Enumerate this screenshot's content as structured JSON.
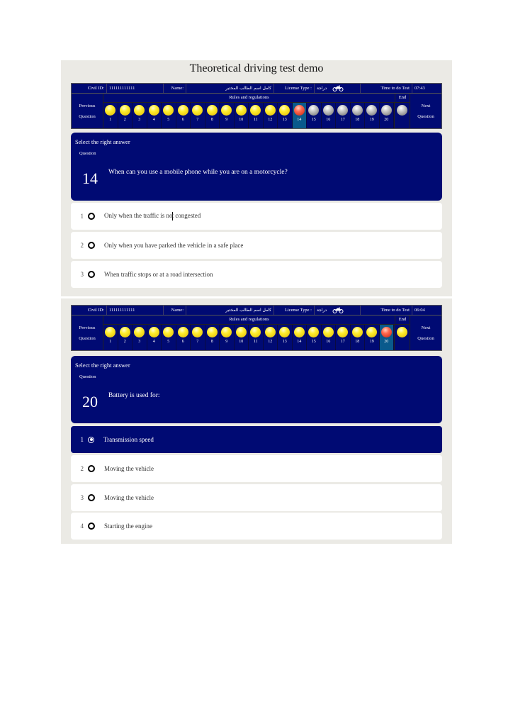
{
  "page": {
    "title": "Theoretical driving test demo"
  },
  "screens": [
    {
      "info": {
        "civil_id_label": "Civil ID:",
        "civil_id": "111111111111",
        "name_label": "Name:",
        "name": "كامل اسم الطالب المختبر",
        "license_label": "License Type :",
        "license": "دراجة",
        "license_icon": "motorcycle-icon",
        "time_label": "Time to do Test",
        "time": "07:43"
      },
      "nav": {
        "previous": [
          "Previous",
          "Question"
        ],
        "next": [
          "Next",
          "Question"
        ],
        "section": "Rules and regulations",
        "end_label": "End",
        "current": 14,
        "questions": [
          {
            "n": "1",
            "state": "answered"
          },
          {
            "n": "2",
            "state": "answered"
          },
          {
            "n": "3",
            "state": "answered"
          },
          {
            "n": "4",
            "state": "answered"
          },
          {
            "n": "5",
            "state": "answered"
          },
          {
            "n": "6",
            "state": "answered"
          },
          {
            "n": "7",
            "state": "answered"
          },
          {
            "n": "8",
            "state": "answered"
          },
          {
            "n": "9",
            "state": "answered"
          },
          {
            "n": "10",
            "state": "answered"
          },
          {
            "n": "11",
            "state": "answered"
          },
          {
            "n": "12",
            "state": "answered"
          },
          {
            "n": "13",
            "state": "answered"
          },
          {
            "n": "14",
            "state": "current"
          },
          {
            "n": "15",
            "state": "unanswered"
          },
          {
            "n": "16",
            "state": "unanswered"
          },
          {
            "n": "17",
            "state": "unanswered"
          },
          {
            "n": "18",
            "state": "unanswered"
          },
          {
            "n": "19",
            "state": "unanswered"
          },
          {
            "n": "20",
            "state": "unanswered"
          }
        ],
        "end_state": "unanswered"
      },
      "question": {
        "instruction": "Select the right answer",
        "label": "Question",
        "number": "14",
        "text": "When can you use a mobile phone while you are on a motorcycle?"
      },
      "answers": [
        {
          "n": "1",
          "text_before": "Only when the traffic is no",
          "text_after": "t congested",
          "selected": false
        },
        {
          "n": "2",
          "text": "Only when you have parked the vehicle in a safe place",
          "selected": false
        },
        {
          "n": "3",
          "text": "When traffic stops or at a road intersection",
          "selected": false
        }
      ]
    },
    {
      "info": {
        "civil_id_label": "Civil ID:",
        "civil_id": "111111111111",
        "name_label": "Name:",
        "name": "كامل اسم الطالب المختبر",
        "license_label": "License Type :",
        "license": "دراجة",
        "license_icon": "motorcycle-icon",
        "time_label": "Time to do Test",
        "time": "06:04"
      },
      "nav": {
        "previous": [
          "Previous",
          "Question"
        ],
        "next": [
          "Next",
          "Question"
        ],
        "section": "Rules and regulations",
        "end_label": "End",
        "current": 20,
        "questions": [
          {
            "n": "1",
            "state": "answered"
          },
          {
            "n": "2",
            "state": "answered"
          },
          {
            "n": "3",
            "state": "answered"
          },
          {
            "n": "4",
            "state": "answered"
          },
          {
            "n": "5",
            "state": "answered"
          },
          {
            "n": "6",
            "state": "answered"
          },
          {
            "n": "7",
            "state": "answered"
          },
          {
            "n": "8",
            "state": "answered"
          },
          {
            "n": "9",
            "state": "answered"
          },
          {
            "n": "10",
            "state": "answered"
          },
          {
            "n": "11",
            "state": "answered"
          },
          {
            "n": "12",
            "state": "answered"
          },
          {
            "n": "13",
            "state": "answered"
          },
          {
            "n": "14",
            "state": "answered"
          },
          {
            "n": "15",
            "state": "answered"
          },
          {
            "n": "16",
            "state": "answered"
          },
          {
            "n": "17",
            "state": "answered"
          },
          {
            "n": "18",
            "state": "answered"
          },
          {
            "n": "19",
            "state": "answered"
          },
          {
            "n": "20",
            "state": "current"
          }
        ],
        "end_state": "answered"
      },
      "question": {
        "instruction": "Select the right answer",
        "label": "Question",
        "number": "20",
        "text": "Battery is used for:"
      },
      "answers": [
        {
          "n": "1",
          "text": "Transmission speed",
          "selected": true
        },
        {
          "n": "2",
          "text": "Moving the vehicle",
          "selected": false
        },
        {
          "n": "3",
          "text": "Moving the vehicle",
          "selected": false
        },
        {
          "n": "4",
          "text": "Starting the engine",
          "selected": false
        }
      ]
    }
  ],
  "colors": {
    "panel_navy": "#000a73",
    "current_cell": "#0a5a8c",
    "sheet_bg": "#ebeae5"
  }
}
